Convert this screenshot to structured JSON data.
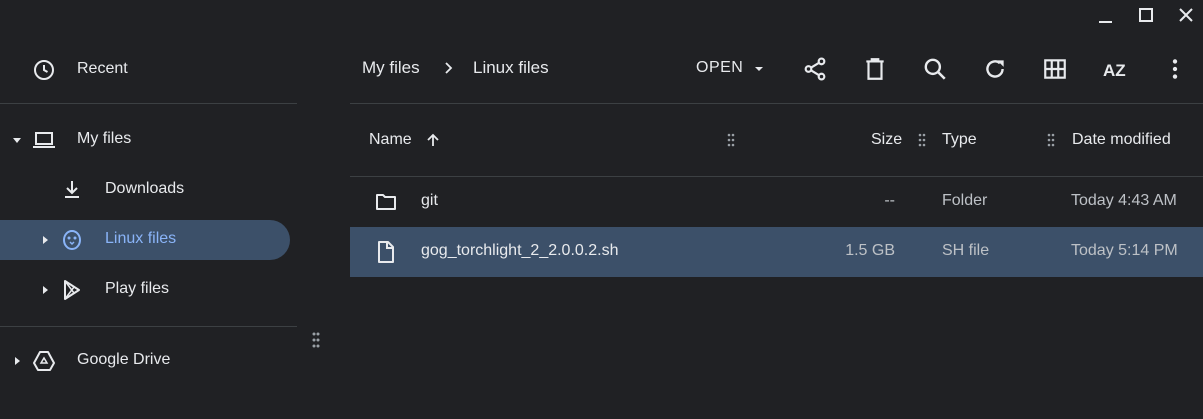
{
  "window_controls": {
    "minimize_icon": "minimize-icon",
    "maximize_icon": "maximize-icon",
    "close_icon": "close-icon"
  },
  "sidebar": {
    "recent": {
      "label": "Recent",
      "icon": "clock-icon"
    },
    "my_files": {
      "label": "My files",
      "icon": "laptop-icon"
    },
    "downloads": {
      "label": "Downloads",
      "icon": "download-icon"
    },
    "linux_files": {
      "label": "Linux files",
      "icon": "penguin-icon"
    },
    "play_files": {
      "label": "Play files",
      "icon": "play-store-icon"
    },
    "google_drive": {
      "label": "Google Drive",
      "icon": "drive-icon"
    }
  },
  "breadcrumb": {
    "items": [
      "My files",
      "Linux files"
    ],
    "separator_icon": "chevron-right-icon"
  },
  "toolbar": {
    "open_label": "OPEN",
    "icons": [
      "share-icon",
      "delete-icon",
      "search-icon",
      "refresh-icon",
      "grid-view-icon",
      "sort-az-icon",
      "more-vert-icon"
    ],
    "sort_label": "AZ"
  },
  "table": {
    "headers": {
      "name": "Name",
      "size": "Size",
      "type": "Type",
      "date": "Date modified"
    },
    "sort_icon": "arrow-up-icon",
    "rows": [
      {
        "name": "git",
        "size": "--",
        "type": "Folder",
        "date": "Today 4:43 AM",
        "icon": "folder-icon",
        "selected": false
      },
      {
        "name": "gog_torchlight_2_2.0.0.2.sh",
        "size": "1.5 GB",
        "type": "SH file",
        "date": "Today 5:14 PM",
        "icon": "file-icon",
        "selected": true
      }
    ]
  },
  "colors": {
    "background": "#202124",
    "selection": "#3c5069",
    "text": "#e8eaed",
    "divider": "#3c4043"
  }
}
